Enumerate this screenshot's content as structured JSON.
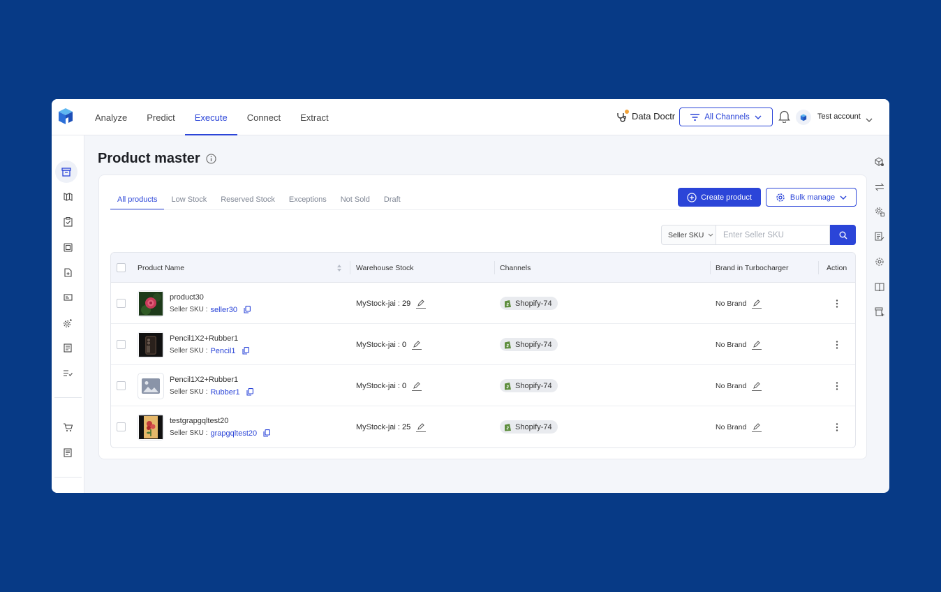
{
  "nav": {
    "items": [
      "Analyze",
      "Predict",
      "Execute",
      "Connect",
      "Extract"
    ],
    "active": "Execute"
  },
  "header": {
    "data_doctr": "Data Doctr",
    "channels_button": "All Channels",
    "account_name": "Test account"
  },
  "page": {
    "title": "Product master"
  },
  "tabs": [
    "All products",
    "Low Stock",
    "Reserved Stock",
    "Exceptions",
    "Not Sold",
    "Draft"
  ],
  "actions": {
    "create": "Create product",
    "bulk": "Bulk manage"
  },
  "search": {
    "field": "Seller SKU",
    "placeholder": "Enter Seller SKU"
  },
  "table": {
    "columns": [
      "Product Name",
      "Warehouse Stock",
      "Channels",
      "Brand in Turbocharger",
      "Action"
    ],
    "sku_label": "Seller SKU :",
    "rows": [
      {
        "name": "product30",
        "sku": "seller30",
        "stock_label": "MyStock-jai :",
        "stock": "29",
        "channel": "Shopify-74",
        "brand": "No Brand"
      },
      {
        "name": "Pencil1X2+Rubber1",
        "sku": "Pencil1",
        "stock_label": "MyStock-jai :",
        "stock": "0",
        "channel": "Shopify-74",
        "brand": "No Brand"
      },
      {
        "name": "Pencil1X2+Rubber1",
        "sku": "Rubber1",
        "stock_label": "MyStock-jai :",
        "stock": "0",
        "channel": "Shopify-74",
        "brand": "No Brand"
      },
      {
        "name": "testgrapgqltest20",
        "sku": "grapgqltest20",
        "stock_label": "MyStock-jai :",
        "stock": "25",
        "channel": "Shopify-74",
        "brand": "No Brand"
      }
    ]
  },
  "colors": {
    "accent": "#2b45d8",
    "background": "#073a86"
  }
}
